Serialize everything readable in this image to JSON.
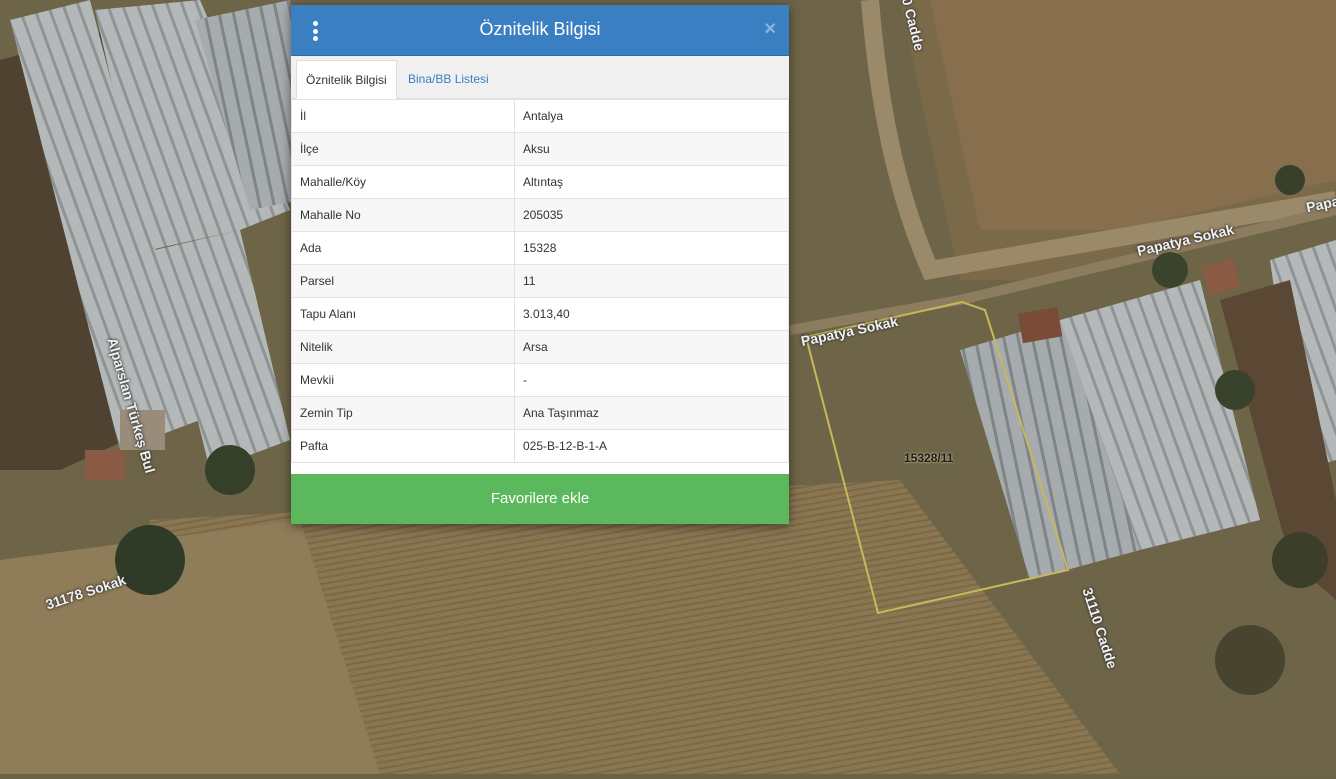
{
  "map": {
    "street_labels": [
      {
        "text": "Papatya Sokak"
      },
      {
        "text": "Papatya Sokak"
      },
      {
        "text": "Papa"
      },
      {
        "text": "Alparslan Türkeş Bul"
      },
      {
        "text": "31178 Sokak"
      },
      {
        "text": "31110 Cadde"
      },
      {
        "text": "0 Cadde"
      }
    ],
    "parcel_label": "15328/11",
    "colors": {
      "parcel_outline": "#c8b85a",
      "ground": "#6b6348",
      "greenhouse": "#a9aeb0"
    }
  },
  "dialog": {
    "title": "Öznitelik Bilgisi",
    "menu_icon": "kebab-menu-icon",
    "close_label": "×",
    "tabs": [
      {
        "label": "Öznitelik Bilgisi",
        "active": true
      },
      {
        "label": "Bina/BB Listesi",
        "active": false
      }
    ],
    "rows": [
      {
        "key": "İl",
        "value": "Antalya"
      },
      {
        "key": "İlçe",
        "value": "Aksu"
      },
      {
        "key": "Mahalle/Köy",
        "value": "Altıntaş"
      },
      {
        "key": "Mahalle No",
        "value": "205035"
      },
      {
        "key": "Ada",
        "value": "15328"
      },
      {
        "key": "Parsel",
        "value": "11"
      },
      {
        "key": "Tapu Alanı",
        "value": "3.013,40"
      },
      {
        "key": "Nitelik",
        "value": "Arsa"
      },
      {
        "key": "Mevkii",
        "value": "-"
      },
      {
        "key": "Zemin Tip",
        "value": "Ana Taşınmaz"
      },
      {
        "key": "Pafta",
        "value": "025-B-12-B-1-A"
      }
    ],
    "favorite_button": "Favorilere ekle",
    "colors": {
      "header": "#3a7fc1",
      "button": "#5cb85c",
      "link": "#3a7fc1"
    }
  }
}
